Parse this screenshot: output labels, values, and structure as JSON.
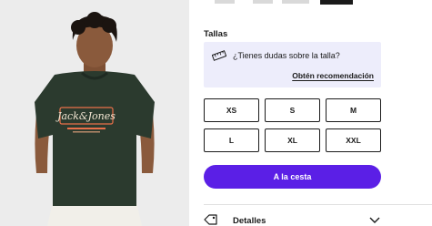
{
  "product": {
    "image_alt": "Model wearing dark green Jack & Jones t-shirt",
    "shirt_logo_text": "Jack&Jones",
    "shirt_color": "#2b3a2e",
    "logo_color": "#e9704a"
  },
  "gallery": {
    "thumbnails": [
      {
        "active": false
      },
      {
        "active": false
      },
      {
        "active": false
      },
      {
        "active": true
      }
    ]
  },
  "sizes": {
    "title": "Tallas",
    "help_question": "¿Tienes dudas sobre la talla?",
    "help_link": "Obtén recomendación",
    "options": [
      "XS",
      "S",
      "M",
      "L",
      "XL",
      "XXL"
    ]
  },
  "cart": {
    "button_label": "A la cesta",
    "color": "#5b1fe6"
  },
  "details": {
    "label": "Detalles"
  }
}
